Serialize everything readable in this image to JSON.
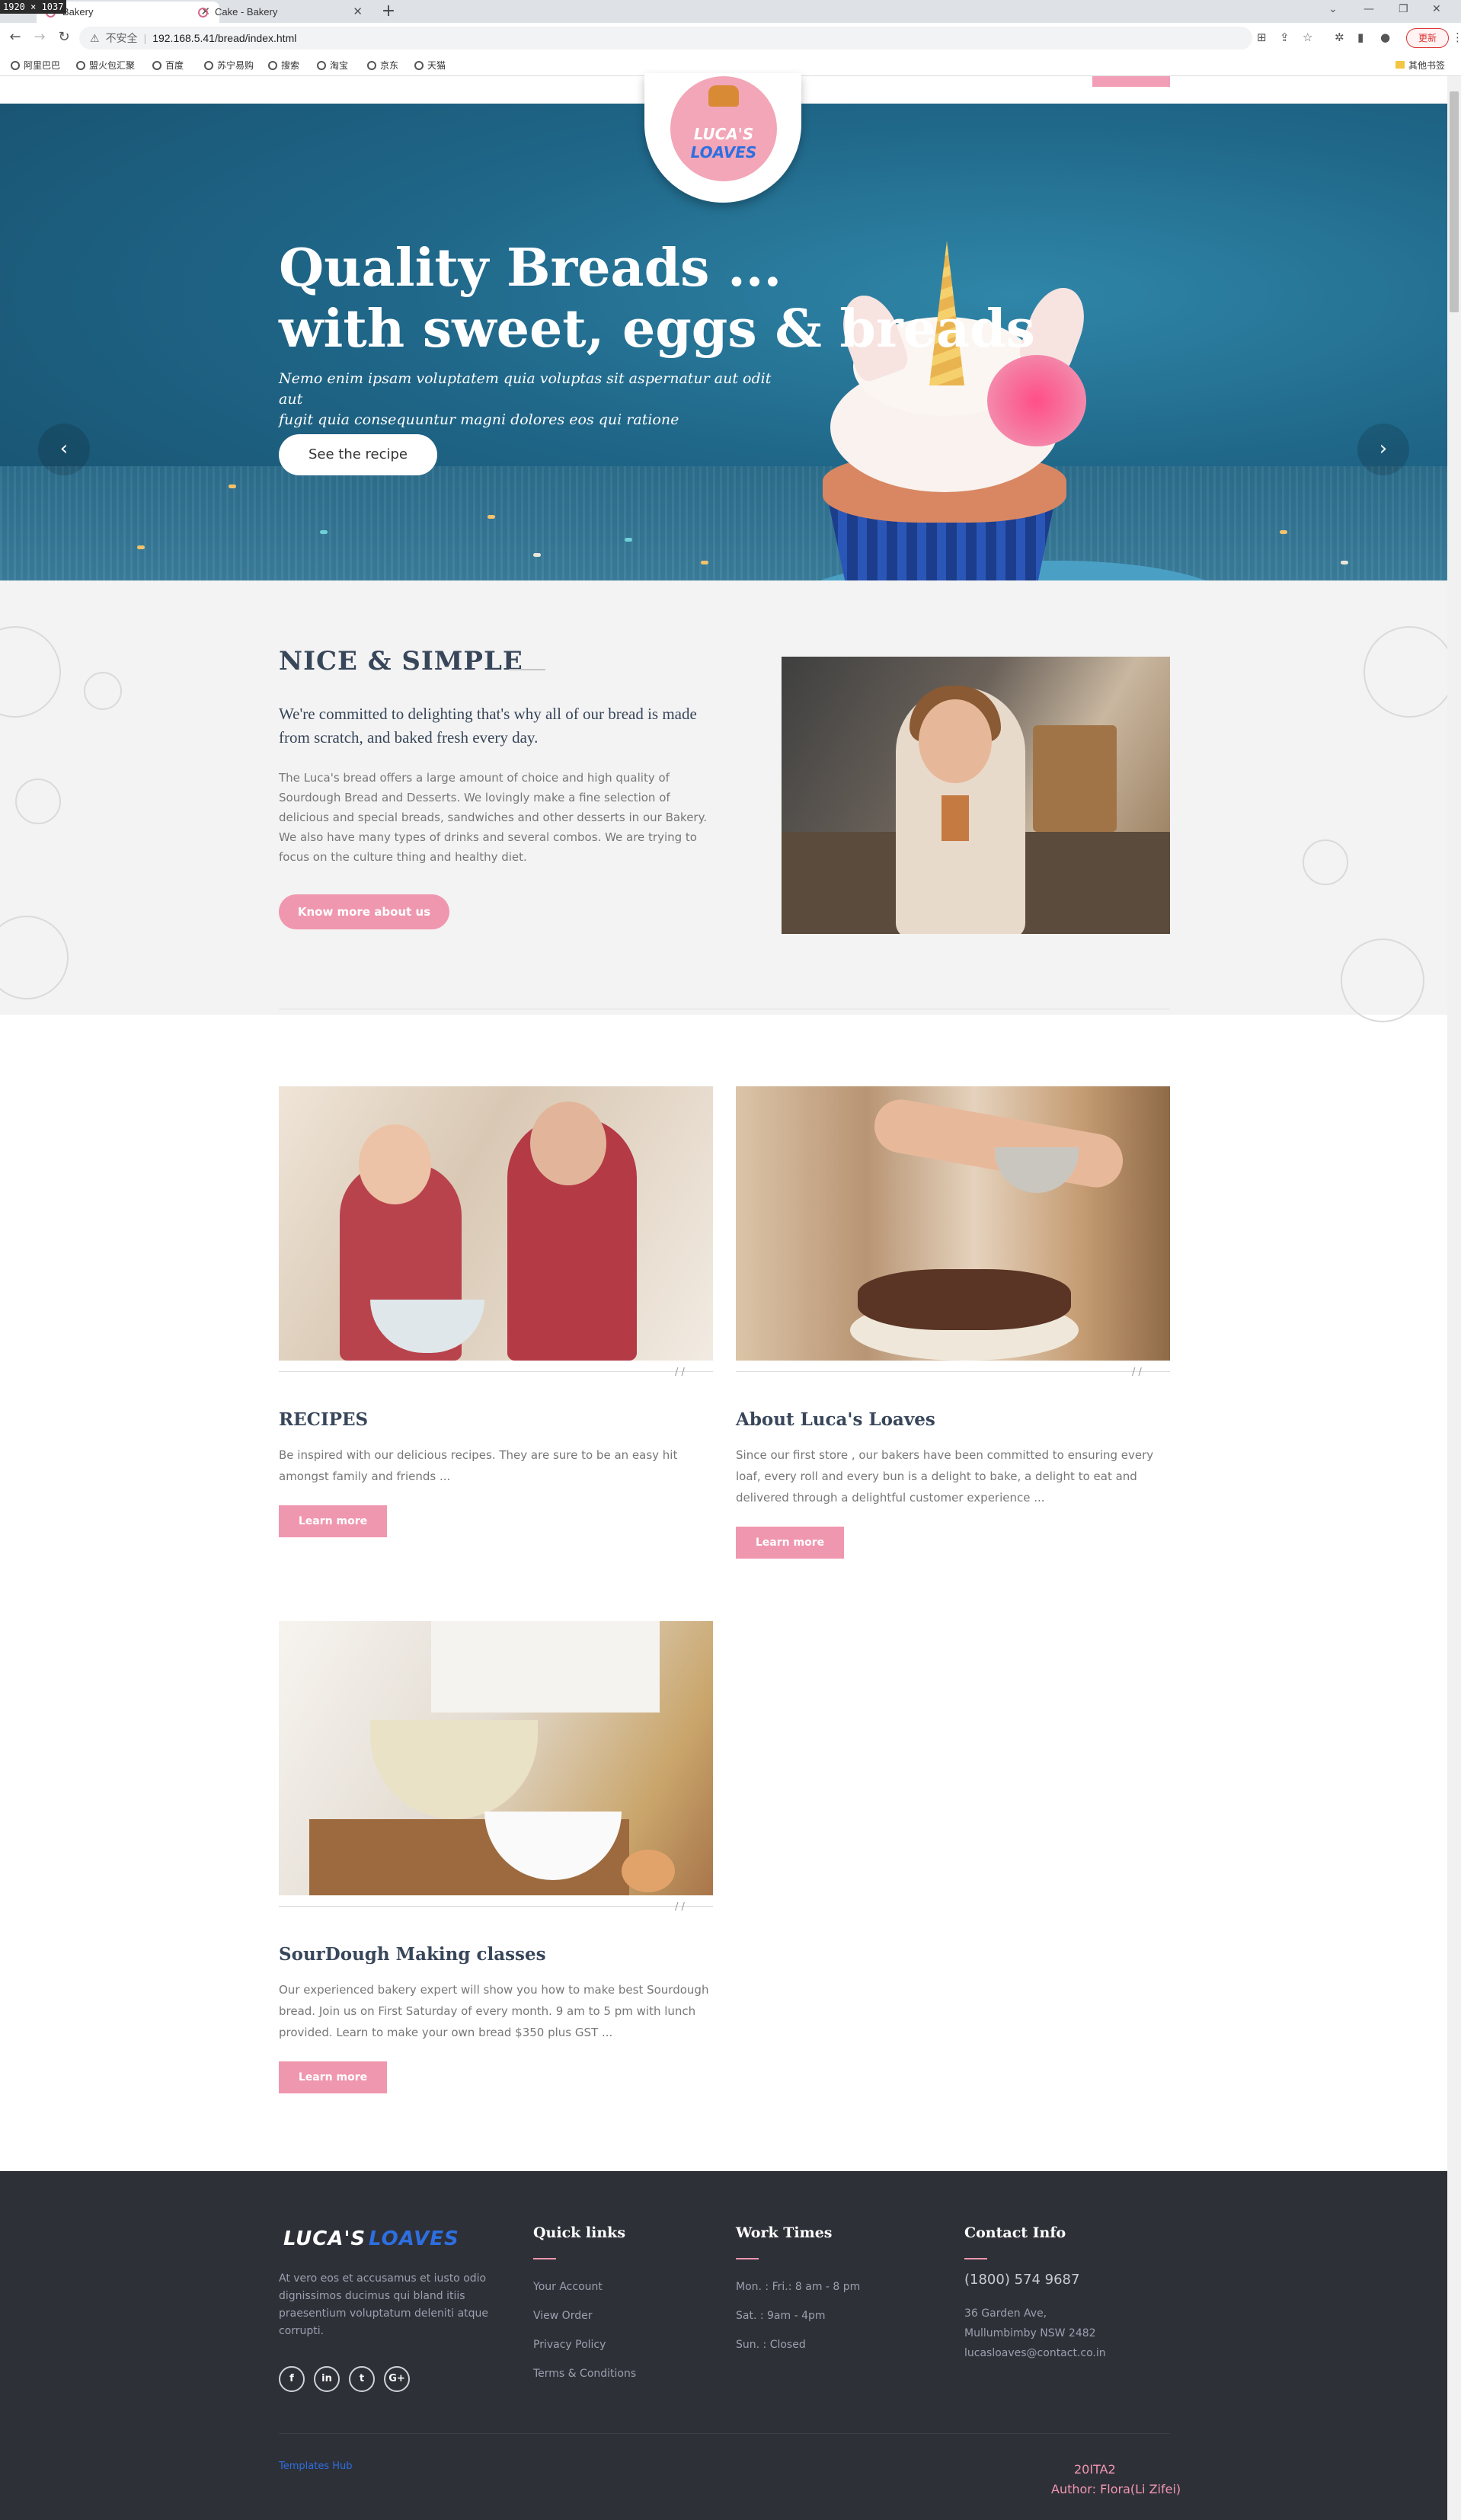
{
  "screenshot_badge": "1920 × 1037",
  "browser": {
    "tabs": [
      {
        "label": "Bakery",
        "active": true
      },
      {
        "label": "Cake - Bakery",
        "active": false
      }
    ],
    "new_tab": "+",
    "insecure_label": "不安全",
    "url": "192.168.5.41/bread/index.html",
    "update_button": "更新",
    "bookmarks": [
      "阿里巴巴",
      "盟火包汇聚",
      "百度",
      "苏宁易购",
      "搜索",
      "淘宝",
      "京东",
      "天猫"
    ],
    "other_bookmarks": "其他书签"
  },
  "logo": {
    "line1": "LUCA'S",
    "line2": "LOAVES"
  },
  "hero": {
    "title_line1": "Quality Breads ...",
    "title_line2": "with sweet, eggs & breads",
    "subtitle_line1": "Nemo enim ipsam voluptatem quia voluptas sit aspernatur aut odit aut",
    "subtitle_line2": "fugit quia consequuntur magni dolores eos qui ratione",
    "button": "See the recipe",
    "prev_arrow": "‹",
    "next_arrow": "›"
  },
  "about": {
    "title": "NICE & SIMPLE",
    "lead": "We're committed to delighting that's why all of our bread is made from scratch, and baked fresh every day.",
    "body": "The Luca's bread offers a large amount of choice and high quality of Sourdough Bread and Desserts. We lovingly make a fine selection of delicious and special breads, sandwiches and other desserts in our Bakery. We also have many types of drinks and several combos. We are trying to focus on the culture thing and healthy diet.",
    "button": "Know more about us"
  },
  "cards": [
    {
      "title": "RECIPES",
      "body": "Be inspired with our delicious recipes. They are sure to be an easy hit amongst family and friends ...",
      "button": "Learn more",
      "marker": "/ /"
    },
    {
      "title": "About Luca's Loaves",
      "body": "Since our first store , our bakers have been committed to ensuring every loaf, every roll and every bun is a delight to bake, a delight to eat and delivered through a delightful customer experience ...",
      "button": "Learn more",
      "marker": "/ /"
    },
    {
      "title": "SourDough Making classes",
      "body": "Our experienced bakery expert will show you how to make best Sourdough bread. Join us on First Saturday of every month. 9 am to 5 pm with lunch provided. Learn to make your own bread $350 plus GST ...",
      "button": "Learn more",
      "marker": "/ /"
    }
  ],
  "footer": {
    "logo1": "LUCA'S",
    "logo2": "LOAVES",
    "about": "At vero eos et accusamus et iusto odio dignissimos ducimus qui bland itiis praesentium voluptatum deleniti atque corrupti.",
    "social": [
      "f",
      "in",
      "t",
      "G+"
    ],
    "quick_links_title": "Quick links",
    "quick_links": [
      "Your Account",
      "View Order",
      "Privacy Policy",
      "Terms & Conditions"
    ],
    "work_times_title": "Work Times",
    "work_times": [
      "Mon. : Fri.: 8 am - 8 pm",
      "Sat. : 9am - 4pm",
      "Sun. : Closed"
    ],
    "contact_title": "Contact Info",
    "phone": "(1800) 574 9687",
    "address": [
      "36 Garden Ave,",
      "Mullumbimby NSW 2482",
      "lucasloaves@contact.co.in"
    ],
    "templates_link": "Templates Hub",
    "class_code": "20ITA2",
    "author": "Author: Flora(Li Zifei)"
  },
  "colors": {
    "accent_pink": "#f097b0",
    "logo_blue": "#2d6fe0",
    "footer_bg": "#2e3038",
    "heading": "#38465a"
  }
}
